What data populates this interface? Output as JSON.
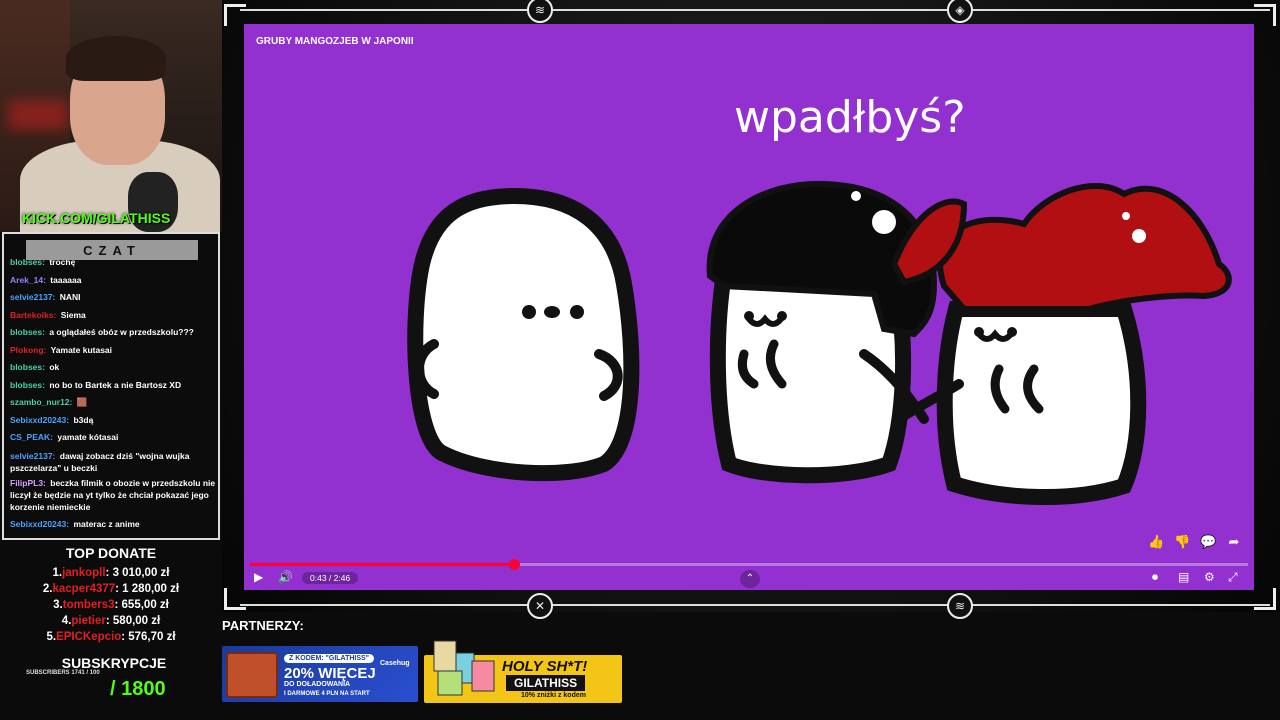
{
  "stream": {
    "kick_label": "KICK.COM/GILATHISS",
    "chat_title": "CZAT"
  },
  "chat": [
    {
      "user": "blobses:",
      "text": "trochę",
      "color": "#4bd0a8"
    },
    {
      "user": "Arek_14:",
      "text": "taaaaaa",
      "color": "#9b7cff"
    },
    {
      "user": "selvie2137:",
      "text": "NANI",
      "color": "#4aa3ff"
    },
    {
      "user": "Bartekoiks:",
      "text": "Siema",
      "color": "#e02020"
    },
    {
      "user": "blobses:",
      "text": "a oglądałeś obóz w przedszkolu???",
      "color": "#4bd0a8"
    },
    {
      "user": "Plokong:",
      "text": "Yamate kutasai",
      "color": "#e02020"
    },
    {
      "user": "blobses:",
      "text": "ok",
      "color": "#4bd0a8"
    },
    {
      "user": "blobses:",
      "text": "no bo to Bartek a nie Bartosz XD",
      "color": "#4bd0a8"
    },
    {
      "user": "szambo_nur12:",
      "text": "🟫",
      "color": "#4bd0a8"
    },
    {
      "user": "Sebixxd20243:",
      "text": "b3dą",
      "color": "#4aa3ff"
    },
    {
      "user": "CS_PEAK:",
      "text": "yamate kótasai",
      "color": "#4aa3ff"
    },
    {
      "user": "selvie2137:",
      "text": "dawaj zobacz dziś \"wojna wujka pszczelarza\" u beczki",
      "color": "#4aa3ff"
    },
    {
      "user": "FilipPL3:",
      "text": "beczka filmik o obozie w przedszkolu nie liczył że będzie na yt tylko że chciał pokazać jego korzenie niemieckie",
      "color": "#d6a0ff"
    },
    {
      "user": "Sebixxd20243:",
      "text": "materac z anime",
      "color": "#4aa3ff"
    }
  ],
  "top_donate": {
    "title": "TOP DONATE",
    "rows": [
      {
        "n": "1.",
        "name": "jankopll",
        "amount": ": 3 010,00 zł"
      },
      {
        "n": "2.",
        "name": "kacper4377",
        "amount": ": 1 280,00 zł"
      },
      {
        "n": "3.",
        "name": "tombers3",
        "amount": ": 655,00 zł"
      },
      {
        "n": "4.",
        "name": "pietier",
        "amount": ": 580,00 zł"
      },
      {
        "n": "5.",
        "name": "EPICKepcio",
        "amount": ": 576,70 zł"
      }
    ]
  },
  "subs": {
    "title": "SUBSKRYPCJE",
    "small": "SUBSCRIBERS 1741 / 100",
    "count": "/ 1800"
  },
  "video": {
    "title": "GRUBY MANGOZJEB W JAPONII",
    "caption": "wpadłbyś?",
    "time": "0:43 / 2:46",
    "progress": 0.265,
    "background": "#9230d0"
  },
  "partners": {
    "label": "PARTNERZY:",
    "b1_code": "Z KODEM: \"GILATHISS\"",
    "b1_big": "20% WIĘCEJ",
    "b1_mid": "DO DOŁADOWANIA",
    "b1_small": "I DARMOWE 4 PLN NA START",
    "b1_logo": "Casehug",
    "b2_title": "HOLY SH*T!",
    "b2_code": "GILATHISS",
    "b2_small": "10% zniżki z kodem"
  }
}
